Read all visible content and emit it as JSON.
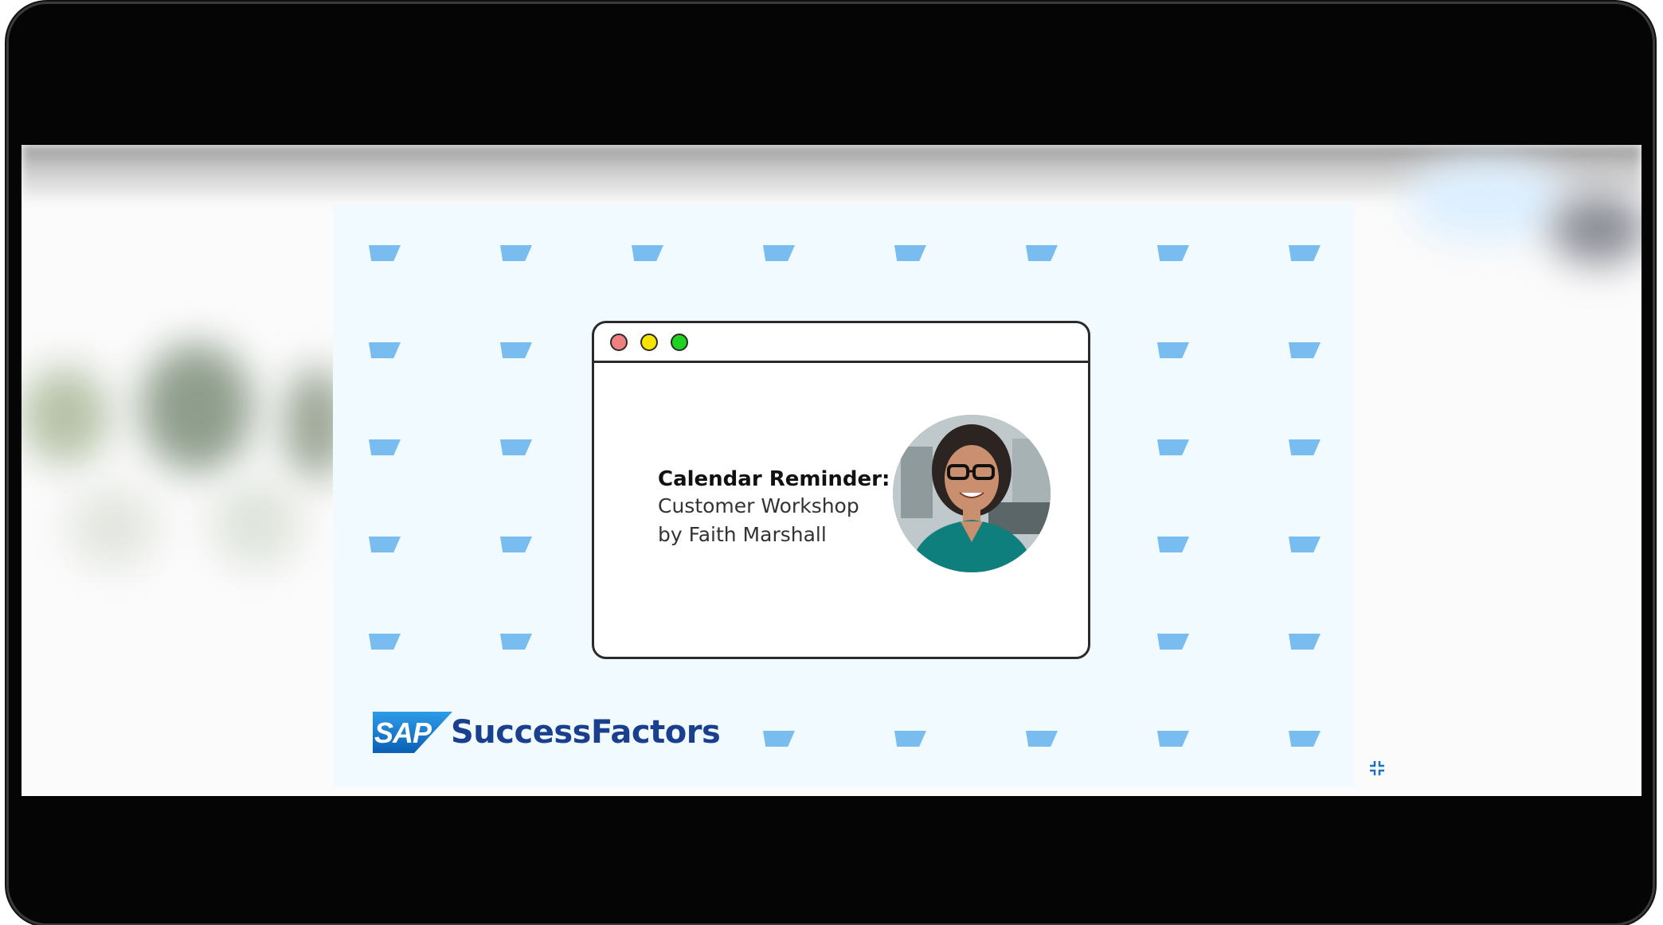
{
  "slide": {
    "reminder_title": "Calendar Reminder:",
    "reminder_line1": "Customer Workshop",
    "reminder_line2": "by Faith Marshall",
    "brand_sap": "SAP",
    "brand_name": "SuccessFactors"
  },
  "window_controls": [
    {
      "name": "close-dot",
      "color": "#f08080"
    },
    {
      "name": "minimize-dot",
      "color": "#f5e400"
    },
    {
      "name": "maximize-dot",
      "color": "#1fd21f"
    }
  ],
  "icons": {
    "exit_fullscreen": "exit-fullscreen-icon",
    "flag_decor": "flag-icon"
  },
  "colors": {
    "flag": "#79bdf0",
    "slide_bg": "#f0faff",
    "brand_blue": "#1b3f8f",
    "accent_icon": "#1a73c8"
  }
}
